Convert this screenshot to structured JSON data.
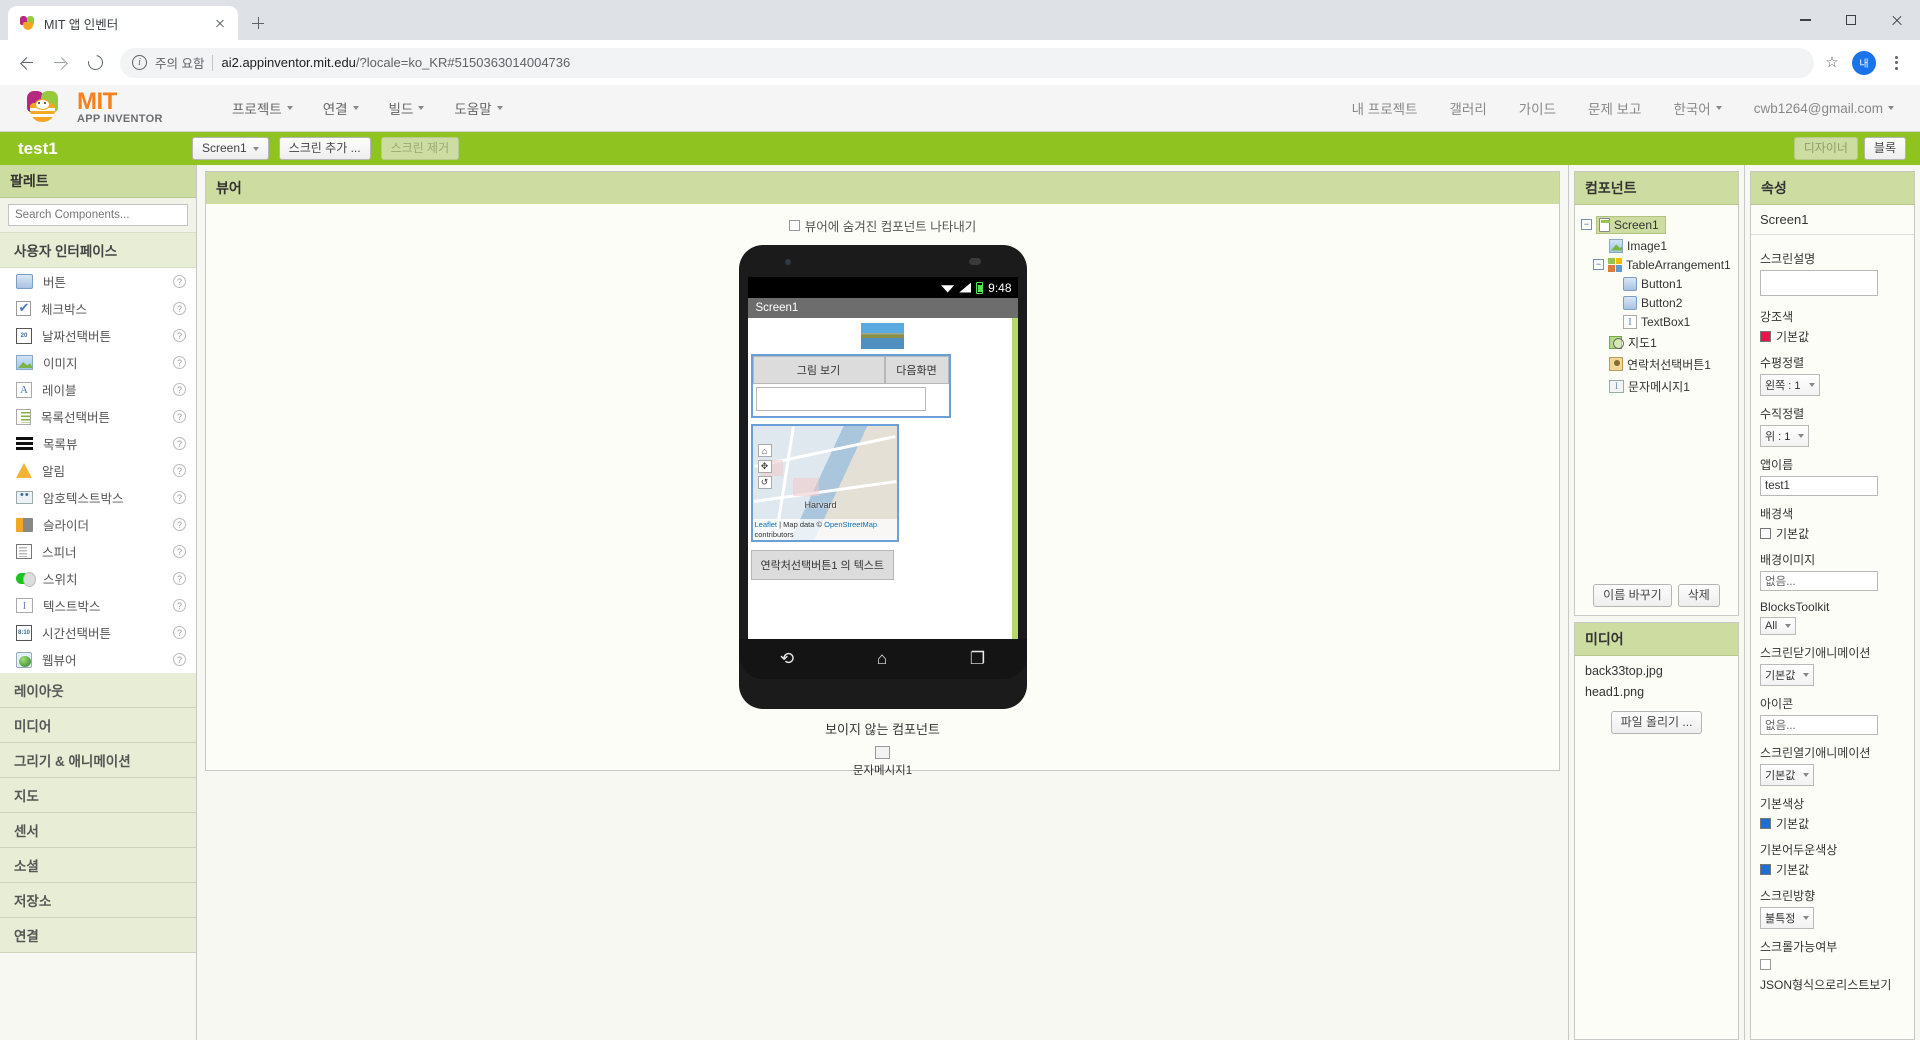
{
  "browser": {
    "tab_title": "MIT 앱 인벤터",
    "warning_text": "주의 요함",
    "url_domain": "ai2.appinventor.mit.edu",
    "url_path": "/?locale=ko_KR#5150363014004736",
    "profile_initial": "내"
  },
  "header": {
    "logo_mit": "MIT",
    "logo_sub": "APP INVENTOR",
    "menus": [
      "프로젝트",
      "연결",
      "빌드",
      "도움말"
    ],
    "right_links": [
      "내 프로젝트",
      "갤러리",
      "가이드",
      "문제 보고"
    ],
    "language": "한국어",
    "account": "cwb1264@gmail.com"
  },
  "projectbar": {
    "project_name": "test1",
    "screen_select": "Screen1",
    "add_screen": "스크린 추가 ...",
    "remove_screen": "스크린 제거",
    "designer": "디자이너",
    "blocks": "블록"
  },
  "palette": {
    "title": "팔레트",
    "search_placeholder": "Search Components...",
    "category_open": "사용자 인터페이스",
    "components": [
      {
        "label": "버튼",
        "icon": "button-icon"
      },
      {
        "label": "체크박스",
        "icon": "checkbox-icon"
      },
      {
        "label": "날짜선택버튼",
        "icon": "datepicker-icon"
      },
      {
        "label": "이미지",
        "icon": "image-icon"
      },
      {
        "label": "레이블",
        "icon": "label-icon"
      },
      {
        "label": "목록선택버튼",
        "icon": "listpicker-icon"
      },
      {
        "label": "목록뷰",
        "icon": "listview-icon"
      },
      {
        "label": "알림",
        "icon": "notifier-icon"
      },
      {
        "label": "암호텍스트박스",
        "icon": "passwordbox-icon"
      },
      {
        "label": "슬라이더",
        "icon": "slider-icon"
      },
      {
        "label": "스피너",
        "icon": "spinner-icon"
      },
      {
        "label": "스위치",
        "icon": "switch-icon"
      },
      {
        "label": "텍스트박스",
        "icon": "textbox-icon"
      },
      {
        "label": "시간선택버튼",
        "icon": "timepicker-icon"
      },
      {
        "label": "웹뷰어",
        "icon": "webviewer-icon"
      }
    ],
    "categories": [
      "레이아웃",
      "미디어",
      "그리기 & 애니메이션",
      "지도",
      "센서",
      "소셜",
      "저장소",
      "연결"
    ]
  },
  "viewer": {
    "title": "뷰어",
    "show_hidden_label": "뷰어에 숨겨진 컴포넌트 나타내기",
    "phone": {
      "status_time": "9:48",
      "screen_title": "Screen1",
      "button1": "그림 보기",
      "button2": "다음화면",
      "map_label": "Harvard",
      "map_attr_prefix": "Leaflet",
      "map_attr_mid": "| Map data ©",
      "map_attr_osm": "OpenStreetMap",
      "map_attr_suffix": "contributors",
      "map_ctrl_top": "⌂",
      "map_ctrl_mid": "✥",
      "map_ctrl_bot": "↺",
      "contact_button": "연락처선택버튼1 의 텍스트"
    },
    "invisible_title": "보이지 않는 컴포넌트",
    "invisible_components": [
      "문자메시지1"
    ]
  },
  "components_panel": {
    "title": "컴포넌트",
    "tree": [
      {
        "label": "Screen1",
        "icon": "screen-icon",
        "depth": 0,
        "expander": "−",
        "selected": true
      },
      {
        "label": "Image1",
        "icon": "image-icon",
        "depth": 1,
        "expander": "",
        "selected": false
      },
      {
        "label": "TableArrangement1",
        "icon": "table-icon",
        "depth": 1,
        "expander": "−",
        "selected": false
      },
      {
        "label": "Button1",
        "icon": "button-icon",
        "depth": 2,
        "expander": "",
        "selected": false
      },
      {
        "label": "Button2",
        "icon": "button-icon",
        "depth": 2,
        "expander": "",
        "selected": false
      },
      {
        "label": "TextBox1",
        "icon": "textbox-icon",
        "depth": 2,
        "expander": "",
        "selected": false
      },
      {
        "label": "지도1",
        "icon": "map-icon",
        "depth": 1,
        "expander": "",
        "selected": false
      },
      {
        "label": "연락처선택버튼1",
        "icon": "contact-icon",
        "depth": 1,
        "expander": "",
        "selected": false
      },
      {
        "label": "문자메시지1",
        "icon": "sms-icon",
        "depth": 1,
        "expander": "",
        "selected": false
      }
    ],
    "rename_button": "이름 바꾸기",
    "delete_button": "삭제"
  },
  "media_panel": {
    "title": "미디어",
    "files": [
      "back33top.jpg",
      "head1.png"
    ],
    "upload_button": "파일 올리기 ..."
  },
  "properties": {
    "title": "속성",
    "selected_component": "Screen1",
    "items": [
      {
        "label": "스크린설명",
        "type": "textarea",
        "value": ""
      },
      {
        "label": "강조색",
        "type": "color",
        "value": "기본값",
        "swatch": "#e8144b"
      },
      {
        "label": "수평정렬",
        "type": "select",
        "value": "왼쪽 : 1"
      },
      {
        "label": "수직정렬",
        "type": "select",
        "value": "위 : 1"
      },
      {
        "label": "앱이름",
        "type": "text",
        "value": "test1"
      },
      {
        "label": "배경색",
        "type": "color",
        "value": "기본값",
        "swatch": "#ffffff"
      },
      {
        "label": "배경이미지",
        "type": "asset",
        "value": "없음..."
      },
      {
        "label": "BlocksToolkit",
        "type": "select",
        "value": "All"
      },
      {
        "label": "스크린닫기애니메이션",
        "type": "select",
        "value": "기본값"
      },
      {
        "label": "아이콘",
        "type": "asset",
        "value": "없음..."
      },
      {
        "label": "스크린열기애니메이션",
        "type": "select",
        "value": "기본값"
      },
      {
        "label": "기본색상",
        "type": "color",
        "value": "기본값",
        "swatch": "#1f6fd0"
      },
      {
        "label": "기본어두운색상",
        "type": "color",
        "value": "기본값",
        "swatch": "#1f6fd0"
      },
      {
        "label": "스크린방향",
        "type": "select",
        "value": "불특정"
      },
      {
        "label": "스크롤가능여부",
        "type": "checkbox",
        "value": ""
      }
    ],
    "footer": "JSON형식으로리스트보기"
  }
}
